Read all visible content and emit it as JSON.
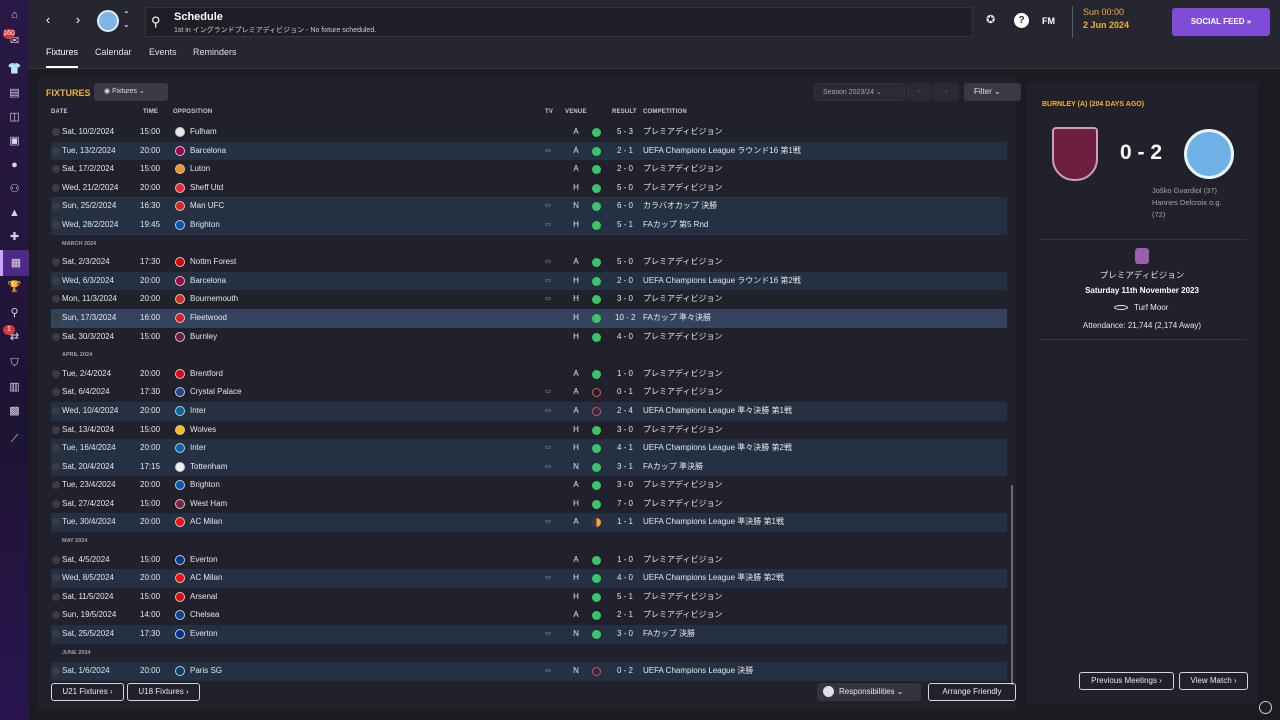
{
  "topbar": {
    "title": "Schedule",
    "subtitle": "1st in イングランドプレミアディビジョン - No fixture scheduled.",
    "time": "Sun 00:00",
    "date": "2 Jun 2024",
    "fm_label": "FM",
    "social_feed": "SOCIAL FEED »"
  },
  "nav_badges": {
    "inbox": "160",
    "alerts": "1"
  },
  "tabs": [
    "Fixtures",
    "Calendar",
    "Events",
    "Reminders"
  ],
  "fixtures": {
    "heading": "FIXTURES",
    "dropdown": "Fixtures",
    "season": "Season 2023/24",
    "filter": "Filter",
    "columns": {
      "date": "DATE",
      "time": "TIME",
      "opposition": "OPPOSITION",
      "tv": "TV",
      "venue": "VENUE",
      "result": "RESULT",
      "competition": "COMPETITION"
    },
    "rows": [
      {
        "date": "Sat, 10/2/2024",
        "time": "15:00",
        "opp": "Fulham",
        "tv": "",
        "venue": "A",
        "res": "w",
        "score": "5 - 3",
        "comp": "プレミアディビジョン",
        "crest": "#e8e8e8",
        "bg": ""
      },
      {
        "date": "Tue, 13/2/2024",
        "time": "20:00",
        "opp": "Barcelona",
        "tv": "▭",
        "venue": "A",
        "res": "w",
        "score": "2 - 1",
        "comp": "UEFA Champions League ラウンド16 第1戦",
        "crest": "#a50044",
        "bg": "alt"
      },
      {
        "date": "Sat, 17/2/2024",
        "time": "15:00",
        "opp": "Luton",
        "tv": "",
        "venue": "A",
        "res": "w",
        "score": "2 - 0",
        "comp": "プレミアディビジョン",
        "crest": "#f78f1e",
        "bg": ""
      },
      {
        "date": "Wed, 21/2/2024",
        "time": "20:00",
        "opp": "Sheff Utd",
        "tv": "",
        "venue": "H",
        "res": "w",
        "score": "5 - 0",
        "comp": "プレミアディビジョン",
        "crest": "#ee2737",
        "bg": ""
      },
      {
        "date": "Sun, 25/2/2024",
        "time": "16:30",
        "opp": "Man UFC",
        "tv": "▭",
        "venue": "N",
        "res": "w",
        "score": "6 - 0",
        "comp": "カラバオカップ 決勝",
        "crest": "#da291c",
        "bg": "alt"
      },
      {
        "date": "Wed, 28/2/2024",
        "time": "19:45",
        "opp": "Brighton",
        "tv": "▭",
        "venue": "H",
        "res": "w",
        "score": "5 - 1",
        "comp": "FAカップ 第5 Rnd",
        "crest": "#0057b8",
        "bg": "alt"
      },
      {
        "month": "MARCH 2024"
      },
      {
        "date": "Sat, 2/3/2024",
        "time": "17:30",
        "opp": "Nottm Forest",
        "tv": "▭",
        "venue": "A",
        "res": "w",
        "score": "5 - 0",
        "comp": "プレミアディビジョン",
        "crest": "#dd0000",
        "bg": ""
      },
      {
        "date": "Wed, 6/3/2024",
        "time": "20:00",
        "opp": "Barcelona",
        "tv": "▭",
        "venue": "H",
        "res": "w",
        "score": "2 - 0",
        "comp": "UEFA Champions League ラウンド16 第2戦",
        "crest": "#a50044",
        "bg": "alt"
      },
      {
        "date": "Mon, 11/3/2024",
        "time": "20:00",
        "opp": "Bournemouth",
        "tv": "▭",
        "venue": "H",
        "res": "w",
        "score": "3 - 0",
        "comp": "プレミアディビジョン",
        "crest": "#da291c",
        "bg": ""
      },
      {
        "date": "Sun, 17/3/2024",
        "time": "16:00",
        "opp": "Fleetwood",
        "tv": "",
        "venue": "H",
        "res": "w",
        "score": "10 - 2",
        "comp": "FAカップ 準々決勝",
        "crest": "#e21a23",
        "bg": "hl"
      },
      {
        "date": "Sat, 30/3/2024",
        "time": "15:00",
        "opp": "Burnley",
        "tv": "",
        "venue": "H",
        "res": "w",
        "score": "4 - 0",
        "comp": "プレミアディビジョン",
        "crest": "#6c1d45",
        "bg": ""
      },
      {
        "month": "APRIL 2024"
      },
      {
        "date": "Tue, 2/4/2024",
        "time": "20:00",
        "opp": "Brentford",
        "tv": "",
        "venue": "A",
        "res": "w",
        "score": "1 - 0",
        "comp": "プレミアディビジョン",
        "crest": "#e30613",
        "bg": ""
      },
      {
        "date": "Sat, 6/4/2024",
        "time": "17:30",
        "opp": "Crystal Palace",
        "tv": "▭",
        "venue": "A",
        "res": "l",
        "score": "0 - 1",
        "comp": "プレミアディビジョン",
        "crest": "#1b458f",
        "bg": ""
      },
      {
        "date": "Wed, 10/4/2024",
        "time": "20:00",
        "opp": "Inter",
        "tv": "▭",
        "venue": "A",
        "res": "l",
        "score": "2 - 4",
        "comp": "UEFA Champions League 準々決勝 第1戦",
        "crest": "#0068a8",
        "bg": "alt"
      },
      {
        "date": "Sat, 13/4/2024",
        "time": "15:00",
        "opp": "Wolves",
        "tv": "",
        "venue": "H",
        "res": "w",
        "score": "3 - 0",
        "comp": "プレミアディビジョン",
        "crest": "#fdb913",
        "bg": ""
      },
      {
        "date": "Tue, 16/4/2024",
        "time": "20:00",
        "opp": "Inter",
        "tv": "▭",
        "venue": "H",
        "res": "w",
        "score": "4 - 1",
        "comp": "UEFA Champions League 準々決勝 第2戦",
        "crest": "#0068a8",
        "bg": "alt"
      },
      {
        "date": "Sat, 20/4/2024",
        "time": "17:15",
        "opp": "Tottenham",
        "tv": "▭",
        "venue": "N",
        "res": "w",
        "score": "3 - 1",
        "comp": "FAカップ 準決勝",
        "crest": "#f0f0f0",
        "bg": "alt"
      },
      {
        "date": "Tue, 23/4/2024",
        "time": "20:00",
        "opp": "Brighton",
        "tv": "",
        "venue": "A",
        "res": "w",
        "score": "3 - 0",
        "comp": "プレミアディビジョン",
        "crest": "#0057b8",
        "bg": ""
      },
      {
        "date": "Sat, 27/4/2024",
        "time": "15:00",
        "opp": "West Ham",
        "tv": "",
        "venue": "H",
        "res": "w",
        "score": "7 - 0",
        "comp": "プレミアディビジョン",
        "crest": "#7a263a",
        "bg": ""
      },
      {
        "date": "Tue, 30/4/2024",
        "time": "20:00",
        "opp": "AC Milan",
        "tv": "▭",
        "venue": "A",
        "res": "d",
        "score": "1 - 1",
        "comp": "UEFA Champions League 準決勝 第1戦",
        "crest": "#fb090b",
        "bg": "alt"
      },
      {
        "month": "MAY 2024"
      },
      {
        "date": "Sat, 4/5/2024",
        "time": "15:00",
        "opp": "Everton",
        "tv": "",
        "venue": "A",
        "res": "w",
        "score": "1 - 0",
        "comp": "プレミアディビジョン",
        "crest": "#003399",
        "bg": ""
      },
      {
        "date": "Wed, 8/5/2024",
        "time": "20:00",
        "opp": "AC Milan",
        "tv": "▭",
        "venue": "H",
        "res": "w",
        "score": "4 - 0",
        "comp": "UEFA Champions League 準決勝 第2戦",
        "crest": "#fb090b",
        "bg": "alt"
      },
      {
        "date": "Sat, 11/5/2024",
        "time": "15:00",
        "opp": "Arsenal",
        "tv": "",
        "venue": "H",
        "res": "w",
        "score": "5 - 1",
        "comp": "プレミアディビジョン",
        "crest": "#ef0107",
        "bg": ""
      },
      {
        "date": "Sun, 19/5/2024",
        "time": "14:00",
        "opp": "Chelsea",
        "tv": "",
        "venue": "A",
        "res": "w",
        "score": "2 - 1",
        "comp": "プレミアディビジョン",
        "crest": "#034694",
        "bg": ""
      },
      {
        "date": "Sat, 25/5/2024",
        "time": "17:30",
        "opp": "Everton",
        "tv": "▭",
        "venue": "N",
        "res": "w",
        "score": "3 - 0",
        "comp": "FAカップ 決勝",
        "crest": "#003399",
        "bg": "alt"
      },
      {
        "month": "JUNE 2024"
      },
      {
        "date": "Sat, 1/6/2024",
        "time": "20:00",
        "opp": "Paris SG",
        "tv": "▭",
        "venue": "N",
        "res": "l",
        "score": "0 - 2",
        "comp": "UEFA Champions League 決勝",
        "crest": "#004170",
        "bg": "alt"
      }
    ],
    "buttons": {
      "u21": "U21 Fixtures ›",
      "u18": "U18 Fixtures ›",
      "responsibilities": "Responsibilities ⌄",
      "arrange": "Arrange Friendly"
    }
  },
  "match_panel": {
    "heading": "BURNLEY (A) (204 DAYS AGO)",
    "score": "0 - 2",
    "scorer1": "Joško Gvardiol (37)",
    "scorer2": "Hannes Delcroix o.g.",
    "scorer2_min": "(72)",
    "competition": "プレミアディビジョン",
    "date": "Saturday 11th November 2023",
    "stadium": "Turf Moor",
    "attendance": "Attendance: 21,744 (2,174 Away)",
    "prev_meetings": "Previous Meetings ›",
    "view_match": "View Match ›"
  }
}
